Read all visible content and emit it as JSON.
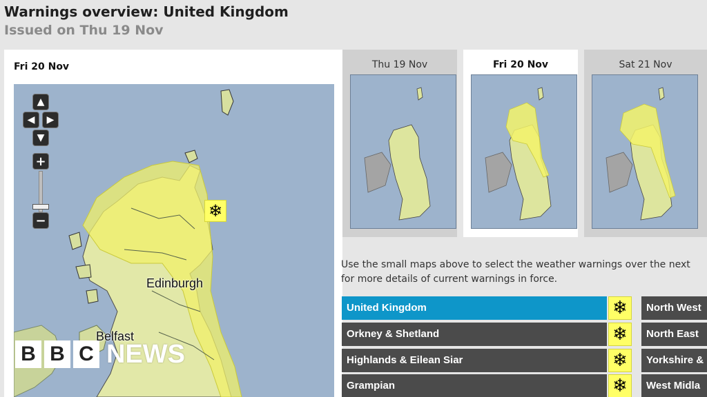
{
  "header": {
    "title": "Warnings overview: United Kingdom",
    "subtitle": "Issued on Thu 19 Nov"
  },
  "main_map": {
    "date": "Fri 20 Nov",
    "labels": {
      "edinburgh": "Edinburgh",
      "belfast": "Belfast"
    },
    "warning_icon": "snowflake-icon",
    "warning_color": "#ffff66",
    "zoom_in": "+",
    "zoom_out": "−"
  },
  "day_tabs": [
    {
      "label": "Thu 19 Nov",
      "active": false
    },
    {
      "label": "Fri 20 Nov",
      "active": true
    },
    {
      "label": "Sat 21 Nov",
      "active": false
    }
  ],
  "description": {
    "line1": "Use the small maps above to select the weather warnings over the next",
    "line2": "for more details of current warnings in force."
  },
  "regions": [
    {
      "name": "United Kingdom",
      "selected": true,
      "icon": "❄"
    },
    {
      "name": "Orkney & Shetland",
      "selected": false,
      "icon": "❄"
    },
    {
      "name": "Highlands & Eilean Siar",
      "selected": false,
      "icon": "❄"
    },
    {
      "name": "Grampian",
      "selected": false,
      "icon": "❄"
    }
  ],
  "regions_col2": [
    {
      "name": "North West"
    },
    {
      "name": "North East"
    },
    {
      "name": "Yorkshire &"
    },
    {
      "name": "West Midla"
    }
  ],
  "watermark": {
    "b1": "B",
    "b2": "B",
    "c": "C",
    "news": "NEWS"
  },
  "colors": {
    "selected_region": "#0e96c9",
    "region_bg": "#4b4b4b",
    "sea": "#9db3cc",
    "land": "#e2e8a8",
    "warning": "#ffff66"
  }
}
